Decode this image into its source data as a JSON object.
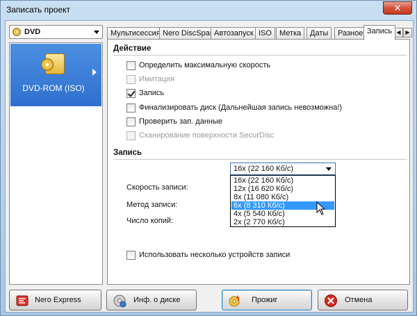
{
  "window": {
    "title": "Записать проект",
    "close_label": "✕"
  },
  "left": {
    "disc_type": "DVD",
    "recorder": "DVD-ROM (ISO)"
  },
  "tabs": [
    "Мультисессия",
    "Nero DiscSpan",
    "Автозапуск",
    "ISO",
    "Метка",
    "Даты",
    "Разное",
    "Запись"
  ],
  "active_tab": "Запись",
  "tab_scroll": {
    "left": "◀",
    "right": "▶"
  },
  "action": {
    "title": "Действие",
    "options": [
      {
        "label": "Определить максимальную скорость",
        "checked": false,
        "disabled": false
      },
      {
        "label": "Имитация",
        "checked": false,
        "disabled": true
      },
      {
        "label": "Запись",
        "checked": true,
        "disabled": false
      },
      {
        "label": "Финализировать диск (Дальнейшая запись невозможна!)",
        "checked": false,
        "disabled": false
      },
      {
        "label": "Проверить зап. данные",
        "checked": false,
        "disabled": false
      },
      {
        "label": "Сканирование поверхности SecurDisc",
        "checked": false,
        "disabled": true
      }
    ]
  },
  "write": {
    "title": "Запись",
    "speed_label": "Скорость записи:",
    "speed_value": "16x (22 160 Кб/с)",
    "method_label": "Метод записи:",
    "copies_label": "Число копий:",
    "speed_options": [
      "16x (22 160 Кб/с)",
      "12x (16 620 Кб/с)",
      "8x (11 080 Кб/с)",
      "6x (8 310 Кб/с)",
      "4x (5 540 Кб/с)",
      "2x (2 770 Кб/с)"
    ],
    "highlighted_option": "6x (8 310 Кб/с)",
    "multi_recorder_label": "Использовать несколько устройств записи",
    "multi_recorder_checked": false
  },
  "buttons": {
    "nero_express": "Nero Express",
    "disc_info": "Инф. о диске",
    "burn": "Прожиг",
    "cancel": "Отмена"
  },
  "colors": {
    "selection": "#3399ff",
    "recorder_bg": "#2f6fcf",
    "close": "#c43a1f"
  }
}
